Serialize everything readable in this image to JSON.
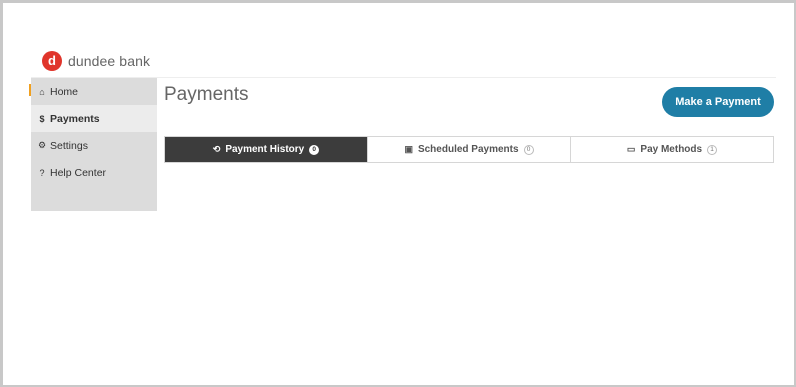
{
  "brand": {
    "logo_letter": "d",
    "name": "dundee bank",
    "accent": "#e0352b"
  },
  "sidebar": {
    "items": [
      {
        "icon": "home-icon",
        "glyph": "⌂",
        "label": "Home"
      },
      {
        "icon": "dollar-icon",
        "glyph": "$",
        "label": "Payments"
      },
      {
        "icon": "gear-icon",
        "glyph": "⚙",
        "label": "Settings"
      },
      {
        "icon": "help-icon",
        "glyph": "?",
        "label": "Help Center"
      }
    ],
    "active_index": 1
  },
  "page": {
    "title": "Payments"
  },
  "cta": {
    "label": "Make a Payment",
    "color": "#1f7ea6"
  },
  "tabs": [
    {
      "icon": "history-icon",
      "glyph": "⟲",
      "label": "Payment History",
      "count": "0"
    },
    {
      "icon": "calendar-icon",
      "glyph": "▣",
      "label": "Scheduled Payments",
      "count": "0"
    },
    {
      "icon": "card-icon",
      "glyph": "▭",
      "label": "Pay Methods",
      "count": "1"
    }
  ],
  "active_tab": 0
}
